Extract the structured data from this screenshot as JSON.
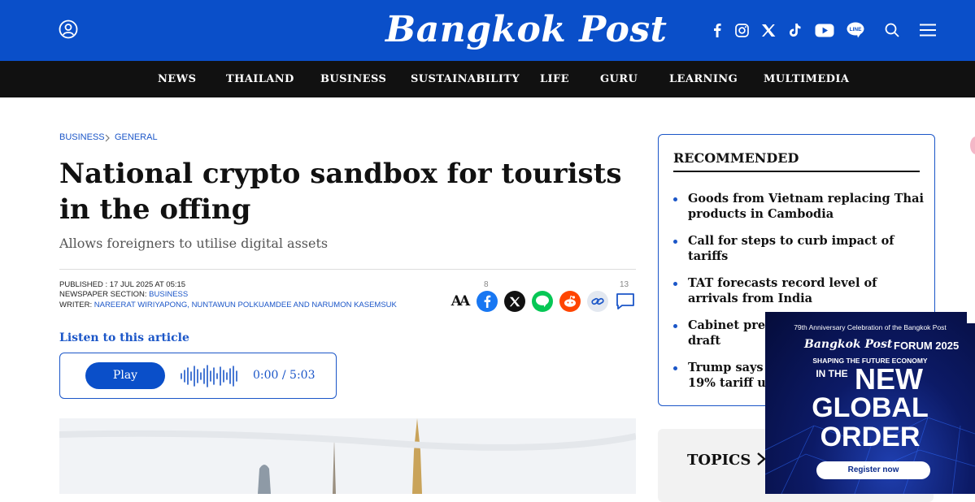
{
  "header": {
    "logo": "Bangkok Post",
    "icons": [
      "user-icon",
      "facebook-icon",
      "instagram-icon",
      "x-icon",
      "tiktok-icon",
      "youtube-icon",
      "line-icon",
      "search-icon",
      "menu-icon"
    ],
    "social_labels": {
      "line": "LINE"
    }
  },
  "nav": {
    "items": [
      "NEWS",
      "THAILAND",
      "BUSINESS",
      "SUSTAINABILITY",
      "LIFE",
      "GURU",
      "LEARNING",
      "MULTIMEDIA"
    ]
  },
  "breadcrumb": {
    "section": "BUSINESS",
    "subsection": "GENERAL"
  },
  "article": {
    "headline": "National crypto sandbox for tourists in the offing",
    "subhead": "Allows foreigners to utilise digital assets",
    "published_label": "PUBLISHED : 17 JUL 2025 AT 05:15",
    "section_label": "NEWSPAPER SECTION: ",
    "section_value": "BUSINESS",
    "writer_label": "WRITER: ",
    "writer_value": "NAREERAT WIRIYAPONG, NUNTAWUN POLKUAMDEE AND NARUMON KASEMSUK"
  },
  "share": {
    "font_size_label": "AA",
    "facebook_count": "8",
    "comment_count": "13"
  },
  "audio": {
    "listen_label": "Listen to this article",
    "play_label": "Play",
    "time": "0:00 / 5:03"
  },
  "recommended": {
    "title": "RECOMMENDED",
    "items": [
      "Goods from Vietnam replacing Thai products in Cambodia",
      "Call for steps to curb impact of tariffs",
      "TAT forecasts record level of arrivals from India",
      "Cabinet prep draft",
      "Trump says I 19% tariff un"
    ]
  },
  "topics": {
    "label": "TOPICS"
  },
  "ad": {
    "top": "79th Anniversary Celebration of the Bangkok Post",
    "logo": "Bangkok Post",
    "forum": "FORUM 2025",
    "tagline": "SHAPING THE FUTURE ECONOMY",
    "in_the": "IN THE",
    "new": "NEW",
    "global": "GLOBAL",
    "order": "ORDER",
    "cta": "Register now"
  },
  "colors": {
    "brand_blue": "#0a4fc9",
    "nav_black": "#111111",
    "link_blue": "#1b56c8"
  }
}
